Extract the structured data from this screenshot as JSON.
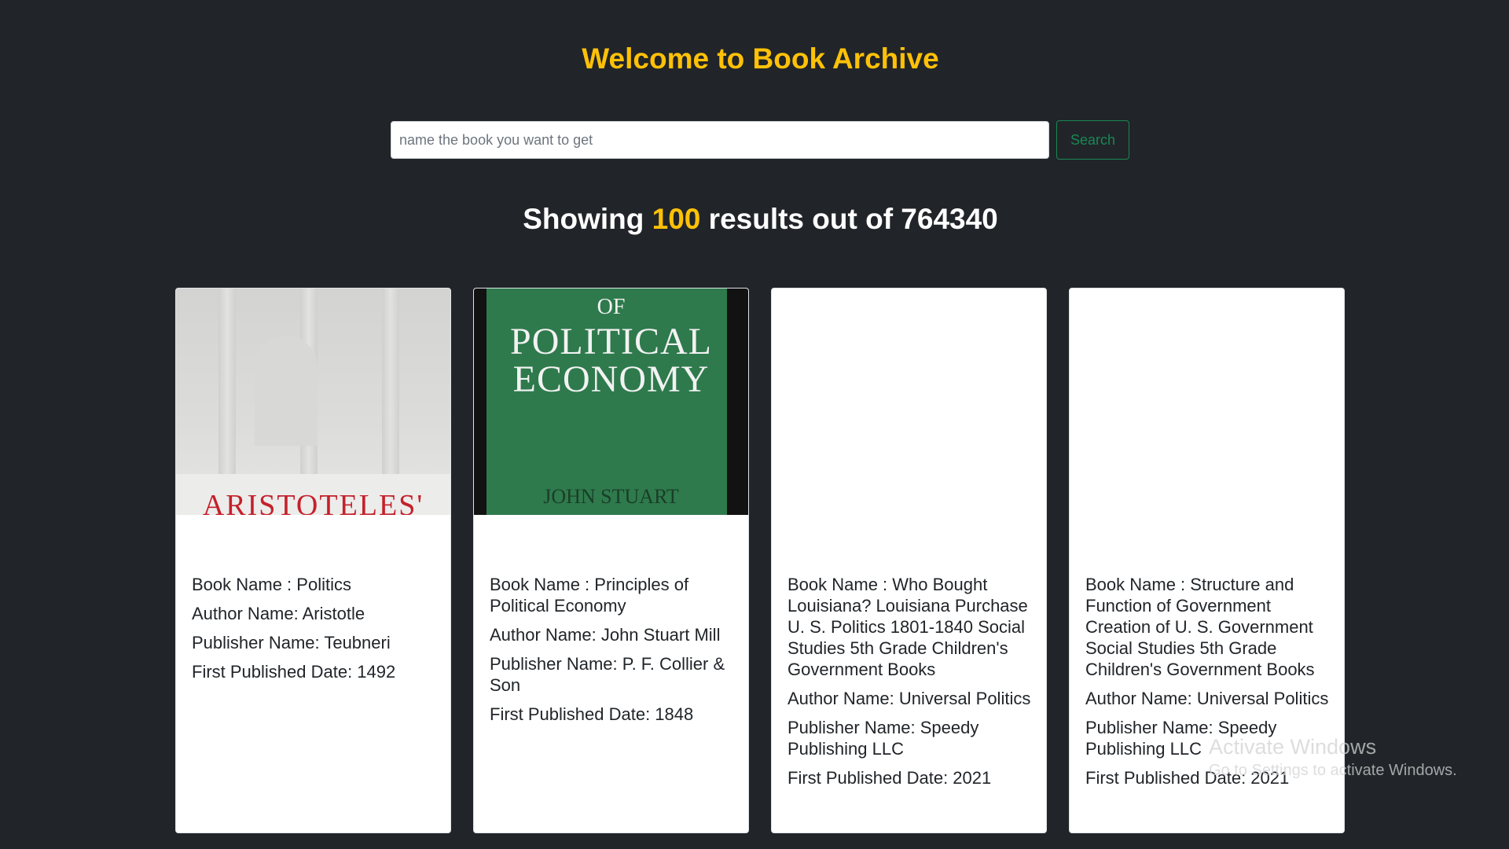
{
  "header": {
    "title": "Welcome to Book Archive"
  },
  "search": {
    "placeholder": "name the book you want to get",
    "value": "",
    "button_label": "Search"
  },
  "results": {
    "prefix": "Showing",
    "count": "100",
    "suffix": "results out of 764340"
  },
  "books": [
    {
      "name": "Book Name : Politics",
      "author": "Author Name: Aristotle",
      "publisher": "Publisher Name: Teubneri",
      "date": "First Published Date: 1492",
      "cover_text": "ARISTOTELES'"
    },
    {
      "name": "Book Name : Principles of Political Economy",
      "author": "Author Name: John Stuart Mill",
      "publisher": "Publisher Name: P. F. Collier & Son",
      "date": "First Published Date: 1848",
      "cover_of": "OF",
      "cover_line1": "POLITICAL",
      "cover_line2": "ECONOMY",
      "cover_author": "JOHN STUART"
    },
    {
      "name": "Book Name : Who Bought Louisiana? Louisiana Purchase U. S. Politics 1801-1840 Social Studies 5th Grade Children's Government Books",
      "author": "Author Name: Universal Politics",
      "publisher": "Publisher Name: Speedy Publishing LLC",
      "date": "First Published Date: 2021"
    },
    {
      "name": "Book Name : Structure and Function of Government Creation of U. S. Government Social Studies 5th Grade Children's Government Books",
      "author": "Author Name: Universal Politics",
      "publisher": "Publisher Name: Speedy Publishing LLC",
      "date": "First Published Date: 2021"
    }
  ],
  "watermark": {
    "line1": "Activate Windows",
    "line2": "Go to Settings to activate Windows."
  },
  "colors": {
    "background": "#212529",
    "accent": "#ffc107",
    "search_button": "#198754"
  }
}
